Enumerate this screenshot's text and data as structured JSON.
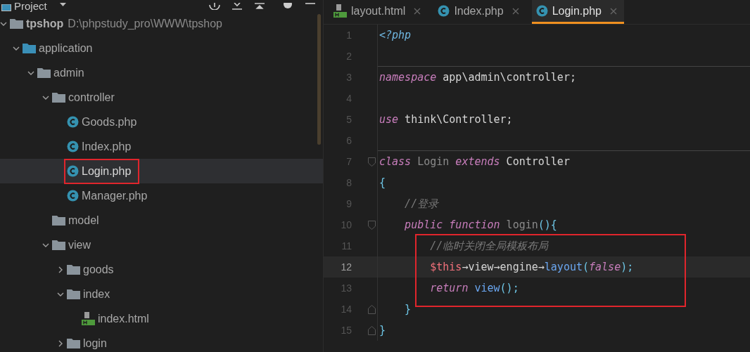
{
  "project_panel": {
    "title": "Project",
    "tree": [
      {
        "name": "tpshop",
        "kind": "folder",
        "bold": true,
        "selected": false,
        "highlighted": false,
        "path": "D:\\phpstudy_pro\\WWW\\tpshop",
        "expanded": true,
        "children": [
          {
            "name": "application",
            "kind": "source-folder",
            "bold": false,
            "selected": false,
            "highlighted": false,
            "expanded": true,
            "children": [
              {
                "name": "admin",
                "kind": "folder",
                "bold": false,
                "selected": false,
                "highlighted": false,
                "expanded": true,
                "children": [
                  {
                    "name": "controller",
                    "kind": "folder",
                    "bold": false,
                    "selected": false,
                    "highlighted": false,
                    "expanded": true,
                    "children": [
                      {
                        "name": "Goods.php",
                        "kind": "class",
                        "bold": false,
                        "selected": false,
                        "highlighted": false
                      },
                      {
                        "name": "Index.php",
                        "kind": "class",
                        "bold": false,
                        "selected": false,
                        "highlighted": false
                      },
                      {
                        "name": "Login.php",
                        "kind": "class",
                        "bold": false,
                        "selected": true,
                        "highlighted": true
                      },
                      {
                        "name": "Manager.php",
                        "kind": "class",
                        "bold": false,
                        "selected": false,
                        "highlighted": false
                      }
                    ]
                  },
                  {
                    "name": "model",
                    "kind": "folder",
                    "bold": false,
                    "selected": false,
                    "highlighted": false
                  },
                  {
                    "name": "view",
                    "kind": "folder",
                    "bold": false,
                    "selected": false,
                    "highlighted": false,
                    "expanded": true,
                    "children": [
                      {
                        "name": "goods",
                        "kind": "folder",
                        "bold": false,
                        "selected": false,
                        "highlighted": false,
                        "expanded": false
                      },
                      {
                        "name": "index",
                        "kind": "folder",
                        "bold": false,
                        "selected": false,
                        "highlighted": false,
                        "expanded": true,
                        "children": [
                          {
                            "name": "index.html",
                            "kind": "html",
                            "bold": false,
                            "selected": false,
                            "highlighted": false
                          }
                        ]
                      },
                      {
                        "name": "login",
                        "kind": "folder",
                        "bold": false,
                        "selected": false,
                        "highlighted": false,
                        "expanded": false
                      }
                    ]
                  }
                ]
              }
            ]
          }
        ]
      }
    ]
  },
  "tabs": [
    {
      "label": "layout.html",
      "kind": "html",
      "selected": false
    },
    {
      "label": "Index.php",
      "kind": "class",
      "selected": false
    },
    {
      "label": "Login.php",
      "kind": "class",
      "selected": true
    }
  ],
  "editor": {
    "lines": [
      {
        "number": "1",
        "kind": "plain",
        "separator_after": false,
        "current": false,
        "highlighted": false,
        "tokens": [
          {
            "text": "<?php",
            "kind": "tag"
          }
        ]
      },
      {
        "number": "2",
        "kind": "plain",
        "separator_after": true,
        "current": false,
        "highlighted": false
      },
      {
        "number": "3",
        "kind": "plain",
        "separator_after": false,
        "current": false,
        "highlighted": false,
        "tokens": [
          {
            "text": "namespace",
            "kind": "keyword"
          },
          {
            "text": " app\\admin\\controller;",
            "kind": "plain"
          }
        ]
      },
      {
        "number": "4",
        "kind": "plain",
        "separator_after": false,
        "current": false,
        "highlighted": false
      },
      {
        "number": "5",
        "kind": "plain",
        "separator_after": false,
        "current": false,
        "highlighted": false,
        "tokens": [
          {
            "text": "use",
            "kind": "keyword"
          },
          {
            "text": " think\\Controller;",
            "kind": "plain"
          }
        ]
      },
      {
        "number": "6",
        "kind": "plain",
        "separator_after": true,
        "current": false,
        "highlighted": false
      },
      {
        "number": "7",
        "kind": "fold-start",
        "separator_after": false,
        "current": false,
        "highlighted": false,
        "tokens": [
          {
            "text": "class",
            "kind": "keyword"
          },
          {
            "text": " Login",
            "kind": "dim"
          },
          {
            "text": " extends",
            "kind": "keyword"
          },
          {
            "text": " Controller",
            "kind": "plain"
          }
        ]
      },
      {
        "number": "8",
        "kind": "plain",
        "separator_after": false,
        "current": false,
        "highlighted": false,
        "tokens": [
          {
            "text": "{",
            "kind": "punct"
          }
        ]
      },
      {
        "number": "9",
        "kind": "plain",
        "separator_after": false,
        "current": false,
        "highlighted": false,
        "tokens": [
          {
            "text": "    //登录",
            "kind": "comment"
          }
        ]
      },
      {
        "number": "10",
        "kind": "fold-start",
        "separator_after": false,
        "current": false,
        "highlighted": false,
        "tokens": [
          {
            "text": "    public",
            "kind": "keyword"
          },
          {
            "text": " function",
            "kind": "keyword"
          },
          {
            "text": " login",
            "kind": "dim"
          },
          {
            "text": "(){",
            "kind": "punct"
          }
        ]
      },
      {
        "number": "11",
        "kind": "plain",
        "separator_after": false,
        "current": false,
        "highlighted": true,
        "tokens": [
          {
            "text": "        //临时关闭全局模板布局",
            "kind": "comment"
          }
        ]
      },
      {
        "number": "12",
        "kind": "plain",
        "separator_after": false,
        "current": true,
        "highlighted": true,
        "tokens": [
          {
            "text": "        $this",
            "kind": "variable"
          },
          {
            "text": "→view→engine→",
            "kind": "plain"
          },
          {
            "text": "layout",
            "kind": "function"
          },
          {
            "text": "(",
            "kind": "punct"
          },
          {
            "text": "false",
            "kind": "keyword"
          },
          {
            "text": ");",
            "kind": "punct"
          }
        ]
      },
      {
        "number": "13",
        "kind": "plain",
        "separator_after": false,
        "current": false,
        "highlighted": true,
        "tokens": [
          {
            "text": "        return",
            "kind": "keyword"
          },
          {
            "text": " view",
            "kind": "function"
          },
          {
            "text": "();",
            "kind": "punct"
          }
        ]
      },
      {
        "number": "14",
        "kind": "fold-end",
        "separator_after": false,
        "current": false,
        "highlighted": false,
        "tokens": [
          {
            "text": "    }",
            "kind": "punct"
          }
        ]
      },
      {
        "number": "15",
        "kind": "fold-end",
        "separator_after": false,
        "current": false,
        "highlighted": false,
        "tokens": [
          {
            "text": "}",
            "kind": "punct"
          }
        ]
      }
    ]
  }
}
